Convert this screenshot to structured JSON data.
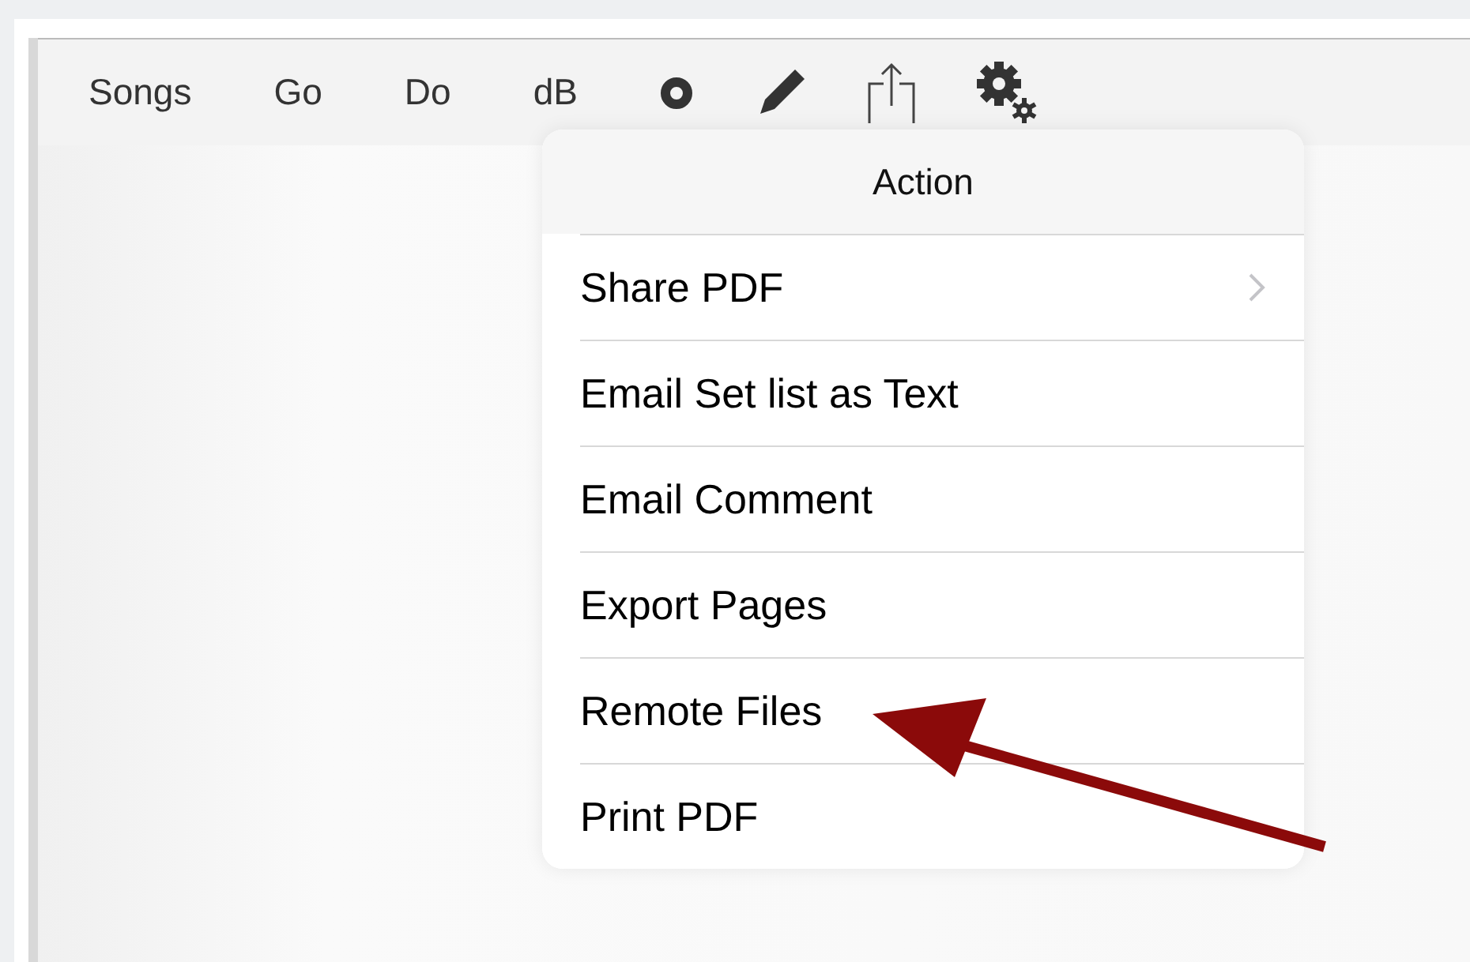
{
  "toolbar": {
    "items": [
      {
        "kind": "text",
        "label": "Songs"
      },
      {
        "kind": "text",
        "label": "Go"
      },
      {
        "kind": "text",
        "label": "Do"
      },
      {
        "kind": "text",
        "label": "dB"
      },
      {
        "kind": "record"
      },
      {
        "kind": "pencil"
      },
      {
        "kind": "share"
      },
      {
        "kind": "settings"
      }
    ]
  },
  "action_menu": {
    "title": "Action",
    "items": [
      {
        "label": "Share PDF",
        "submenu": true
      },
      {
        "label": "Email Set list as Text",
        "submenu": false
      },
      {
        "label": "Email Comment",
        "submenu": false
      },
      {
        "label": "Export Pages",
        "submenu": false
      },
      {
        "label": "Remote Files",
        "submenu": false
      },
      {
        "label": "Print PDF",
        "submenu": false
      }
    ]
  },
  "annotation": {
    "kind": "arrow"
  }
}
